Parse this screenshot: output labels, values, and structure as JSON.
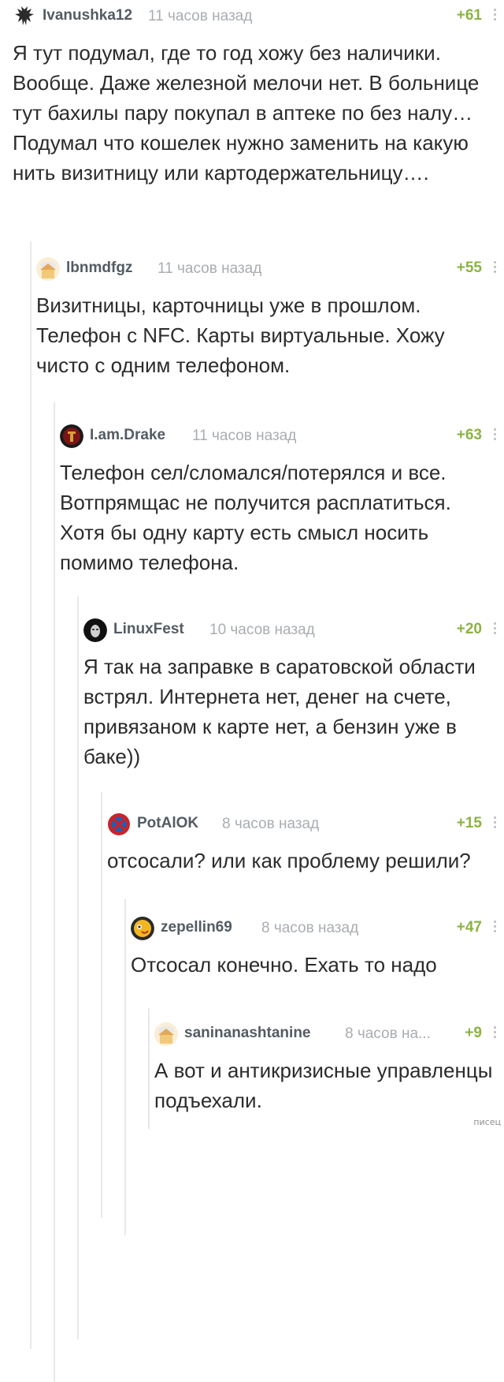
{
  "comments": [
    {
      "author": "Ivanushka12",
      "time": "11 часов назад",
      "rating": "+61",
      "avatar_icon": "dark-winged-creature-icon",
      "text": "Я тут подумал, где то год хожу без наличики. Вообще. Даже железной мелочи нет. В больнице тут бахилы пару покупал в аптеке по без налу… Подумал что кошелек нужно заменить на какую нить визитницу или картодержательницу…."
    },
    {
      "author": "lbnmdfgz",
      "time": "11 часов назад",
      "rating": "+55",
      "avatar_icon": "default-house-avatar-icon",
      "text": "Визитницы, карточницы уже в прошлом. Телефон с NFC. Карты виртуальные. Хожу чисто с одним телефоном."
    },
    {
      "author": "I.am.Drake",
      "time": "11 часов назад",
      "rating": "+63",
      "avatar_icon": "red-emblem-avatar-icon",
      "text": "Телефон сел/сломался/потерялся и все. Вотпрямщас не получится расплатиться. Хотя бы одну карту есть смысл носить помимо телефона."
    },
    {
      "author": "LinuxFest",
      "time": "10 часов назад",
      "rating": "+20",
      "avatar_icon": "hooded-mask-avatar-icon",
      "text": "Я так на заправке в саратовской области встрял. Интернета нет, денег на счете, привязаном к карте нет, а бензин уже в баке))"
    },
    {
      "author": "PotAlOK",
      "time": "8 часов назад",
      "rating": "+15",
      "avatar_icon": "no-parking-sign-avatar-icon",
      "text": "отсосали? или как проблему решили?"
    },
    {
      "author": "zepellin69",
      "time": "8 часов назад",
      "rating": "+47",
      "avatar_icon": "yellow-blob-avatar-icon",
      "text": "Отсосал конечно. Ехать то надо"
    },
    {
      "author": "saninanashtanine",
      "time": "8 часов на...",
      "rating": "+9",
      "avatar_icon": "default-house-avatar-icon",
      "text": "А вот и антикризисные управленцы подъехали."
    }
  ],
  "watermark": "писец",
  "colors": {
    "author": "#535b63",
    "time": "#a9adb1",
    "rating": "#8bb344",
    "text": "#2b2b2b",
    "thread_line": "#e8e8e8"
  }
}
